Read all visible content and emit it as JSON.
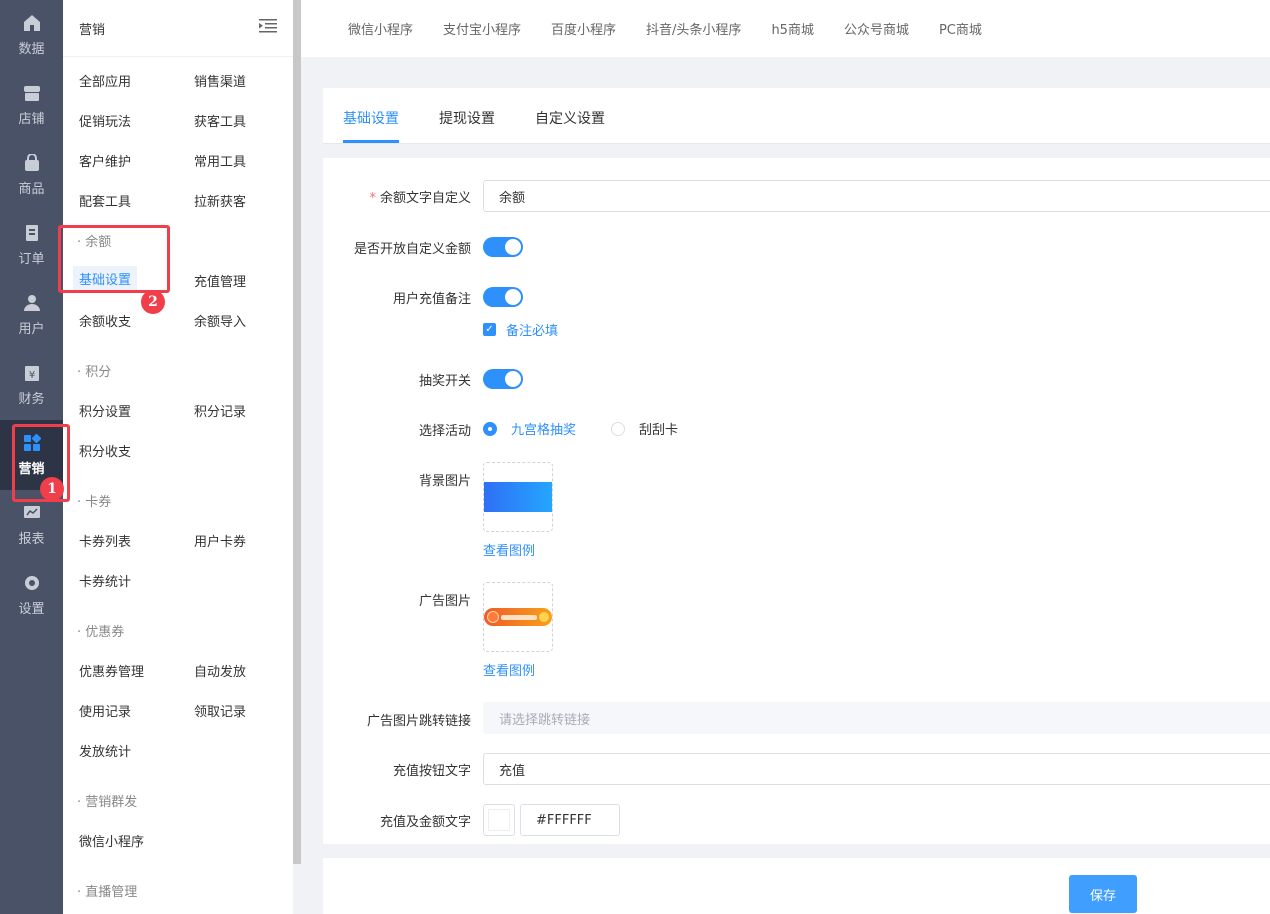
{
  "rail": {
    "items": [
      {
        "label": "数据",
        "icon": "home-icon"
      },
      {
        "label": "店铺",
        "icon": "store-icon"
      },
      {
        "label": "商品",
        "icon": "bag-icon"
      },
      {
        "label": "订单",
        "icon": "order-icon"
      },
      {
        "label": "用户",
        "icon": "user-icon"
      },
      {
        "label": "财务",
        "icon": "finance-icon"
      },
      {
        "label": "营销",
        "icon": "apps-icon"
      },
      {
        "label": "报表",
        "icon": "report-icon"
      },
      {
        "label": "设置",
        "icon": "gear-icon"
      }
    ],
    "active": "营销"
  },
  "submenu": {
    "title": "营销",
    "rows": [
      [
        "全部应用",
        "销售渠道"
      ],
      [
        "促销玩法",
        "获客工具"
      ],
      [
        "客户维护",
        "常用工具"
      ],
      [
        "配套工具",
        "拉新获客"
      ]
    ],
    "groups": {
      "balance": {
        "title": "· 余额",
        "items": [
          "基础设置",
          "充值管理",
          "余额收支",
          "余额导入"
        ]
      },
      "points": {
        "title": "· 积分",
        "items": [
          "积分设置",
          "积分记录",
          "积分收支"
        ]
      },
      "cards": {
        "title": "· 卡券",
        "items": [
          "卡券列表",
          "用户卡券",
          "卡券统计"
        ]
      },
      "coupons": {
        "title": "· 优惠券",
        "items": [
          "优惠券管理",
          "自动发放",
          "使用记录",
          "领取记录",
          "发放统计"
        ]
      },
      "mass": {
        "title": "· 营销群发",
        "items": [
          "微信小程序"
        ]
      },
      "live": {
        "title": "· 直播管理"
      }
    }
  },
  "topbar": {
    "tabs": [
      "微信小程序",
      "支付宝小程序",
      "百度小程序",
      "抖音/头条小程序",
      "h5商城",
      "公众号商城",
      "PC商城"
    ]
  },
  "card": {
    "tabs": [
      "基础设置",
      "提现设置",
      "自定义设置"
    ],
    "active_tab": "基础设置"
  },
  "form": {
    "balance_text_label": "余额文字自定义",
    "balance_text_value": "余额",
    "custom_amount_label": "是否开放自定义金额",
    "custom_amount_on": true,
    "recharge_remark_label": "用户充值备注",
    "recharge_remark_on": true,
    "remark_required_label": "备注必填",
    "lottery_label": "抽奖开关",
    "lottery_on": true,
    "activity_label": "选择活动",
    "activity_options": [
      "九宫格抽奖",
      "刮刮卡"
    ],
    "activity_selected": "九宫格抽奖",
    "bg_image_label": "背景图片",
    "view_example": "查看图例",
    "ad_image_label": "广告图片",
    "ad_link_label": "广告图片跳转链接",
    "ad_link_placeholder": "请选择跳转链接",
    "recharge_btn_label": "充值按钮文字",
    "recharge_btn_value": "充值",
    "amount_color_label": "充值及金额文字",
    "amount_color_value": "#FFFFFF"
  },
  "footer": {
    "save_label": "保存"
  },
  "annotations": [
    "1",
    "2"
  ],
  "colors": {
    "accent": "#2e90fa",
    "rail": "#4a5268",
    "annotation": "#f03e4a"
  }
}
